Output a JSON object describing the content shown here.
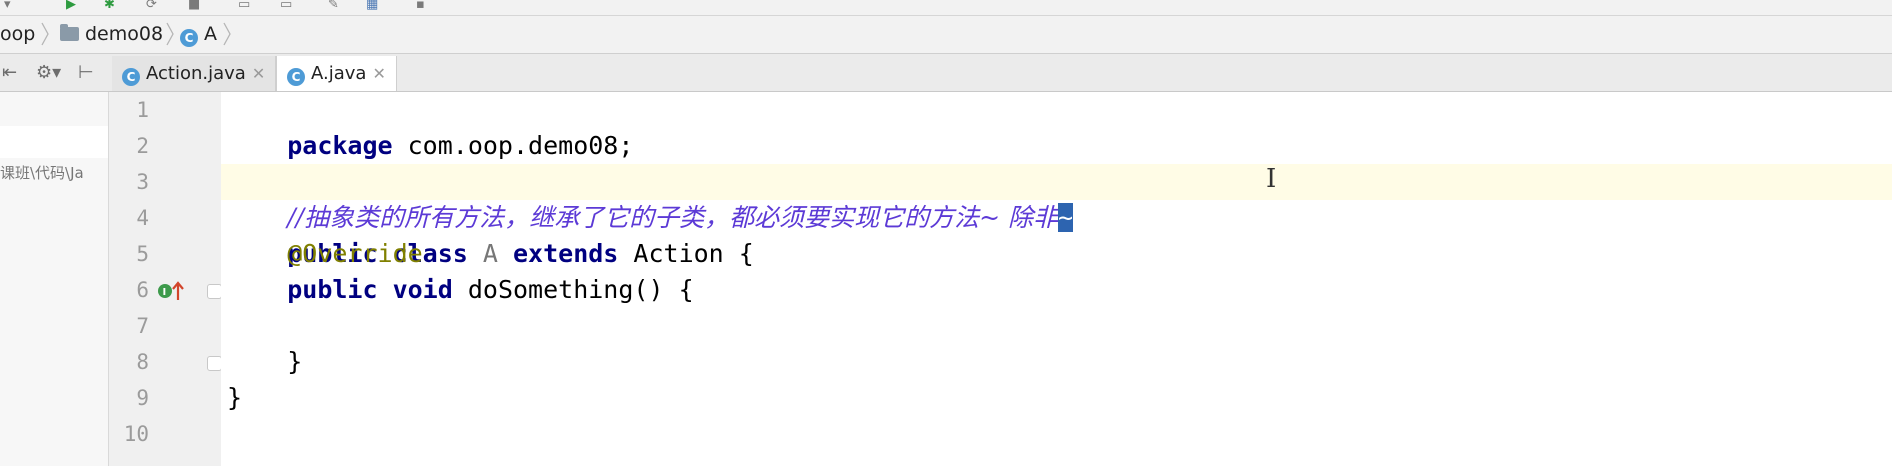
{
  "breadcrumb": {
    "items": [
      {
        "label": "oop",
        "icon": "none"
      },
      {
        "label": "demo08",
        "icon": "folder-icon"
      },
      {
        "label": "A",
        "icon": "class-icon"
      }
    ]
  },
  "tabs": [
    {
      "label": "Action.java",
      "icon": "class-icon",
      "active": false
    },
    {
      "label": "A.java",
      "icon": "class-icon",
      "active": true
    }
  ],
  "project_panel": {
    "path_fragment": "课班\\代码\\Ja"
  },
  "editor": {
    "line_numbers": [
      "1",
      "2",
      "3",
      "4",
      "5",
      "6",
      "7",
      "8",
      "9",
      "10"
    ],
    "current_line": 3,
    "lines": {
      "l1_kw": "package",
      "l1_rest": " com.oop.demo08;",
      "l3_comment": "//抽象类的所有方法，继承了它的子类，都必须要实现它的方法~ 除非",
      "l3_selected": "~",
      "l4_kw1": "public class",
      "l4_name": " A ",
      "l4_kw2": "extends",
      "l4_rest": " Action {",
      "l5_annotation": "@Override",
      "l6_kw": "public void",
      "l6_rest": " doSomething() {",
      "l8_brace": "}",
      "l9_brace": "}"
    }
  },
  "colors": {
    "keyword": "#000080",
    "annotation": "#808000",
    "comment": "#5c3ad6",
    "selection": "#2d64b0",
    "caret_line": "#fffce6"
  }
}
